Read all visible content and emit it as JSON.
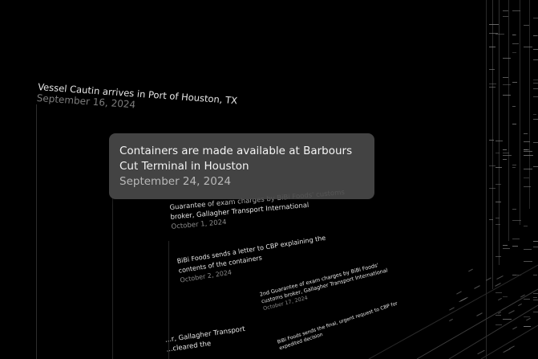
{
  "highlight": {
    "title": "Containers are made available at Barbours Cut Terminal in Houston",
    "date": "September 24, 2024"
  },
  "events": [
    {
      "title": "Vessel Cautin arrives in Port of Houston, TX",
      "date": "September 16, 2024"
    },
    {
      "title_line1": "Guarantee of exam charges by BiBi Foods' customs",
      "title_line2": "broker, Gallagher Transport International",
      "date": "October 1, 2024"
    },
    {
      "title_line1": "BiBi Foods sends a letter to CBP explaining the",
      "title_line2": "contents of the containers",
      "date": "October 2, 2024"
    },
    {
      "title_line1": "2nd Guarantee of exam charges by BiBi Foods'",
      "title_line2": "customs broker, Gallagher Transport International",
      "date": "October 17, 2024"
    },
    {
      "title_line1": "BiBi Foods sends the final, urgent request to CBP for",
      "title_line2": "expedited decision",
      "date": ""
    },
    {
      "title_line1": "...r, Gallagher Transport",
      "title_line2": "...cleared the",
      "date": ""
    }
  ]
}
